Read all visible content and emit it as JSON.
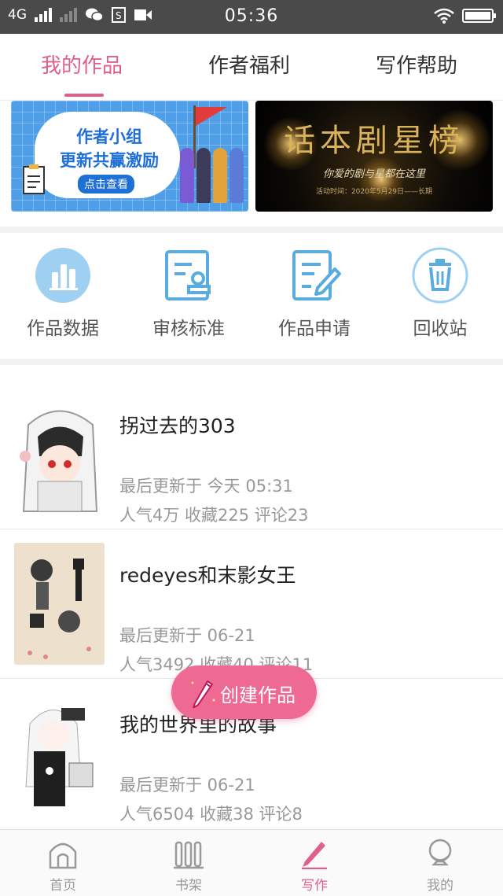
{
  "status_bar": {
    "network": "4G",
    "time": "05:36"
  },
  "tabs": [
    {
      "label": "我的作品",
      "active": true
    },
    {
      "label": "作者福利",
      "active": false
    },
    {
      "label": "写作帮助",
      "active": false
    }
  ],
  "banners": {
    "left": {
      "line1": "作者小组",
      "line2": "更新共赢激励",
      "button": "点击查看"
    },
    "right": {
      "title": "话本剧星榜",
      "subtitle": "你爱的剧与星都在这里",
      "note": "活动时间：2020年5月29日——长期"
    }
  },
  "tools": [
    {
      "label": "作品数据",
      "icon": "bar-chart-icon"
    },
    {
      "label": "审核标准",
      "icon": "review-stamp-icon"
    },
    {
      "label": "作品申请",
      "icon": "edit-document-icon"
    },
    {
      "label": "回收站",
      "icon": "trash-icon"
    }
  ],
  "works": [
    {
      "title": "拐过去的303",
      "updated": "最后更新于 今天 05:31",
      "stats": "人气4万 收藏225 评论23"
    },
    {
      "title": "redeyes和末影女王",
      "updated": "最后更新于 06-21",
      "stats": "人气3492 收藏40 评论11"
    },
    {
      "title": "我的世界里的故事",
      "updated": "最后更新于 06-21",
      "stats": "人气6504 收藏38 评论8"
    }
  ],
  "fab": {
    "label": "创建作品"
  },
  "bottom_nav": [
    {
      "label": "首页",
      "icon": "home-icon"
    },
    {
      "label": "书架",
      "icon": "bookshelf-icon"
    },
    {
      "label": "写作",
      "icon": "pen-icon",
      "active": true
    },
    {
      "label": "我的",
      "icon": "profile-icon"
    }
  ],
  "colors": {
    "accent": "#e0608a",
    "icon_blue": "#5aacde",
    "fab": "#ef6a92"
  }
}
